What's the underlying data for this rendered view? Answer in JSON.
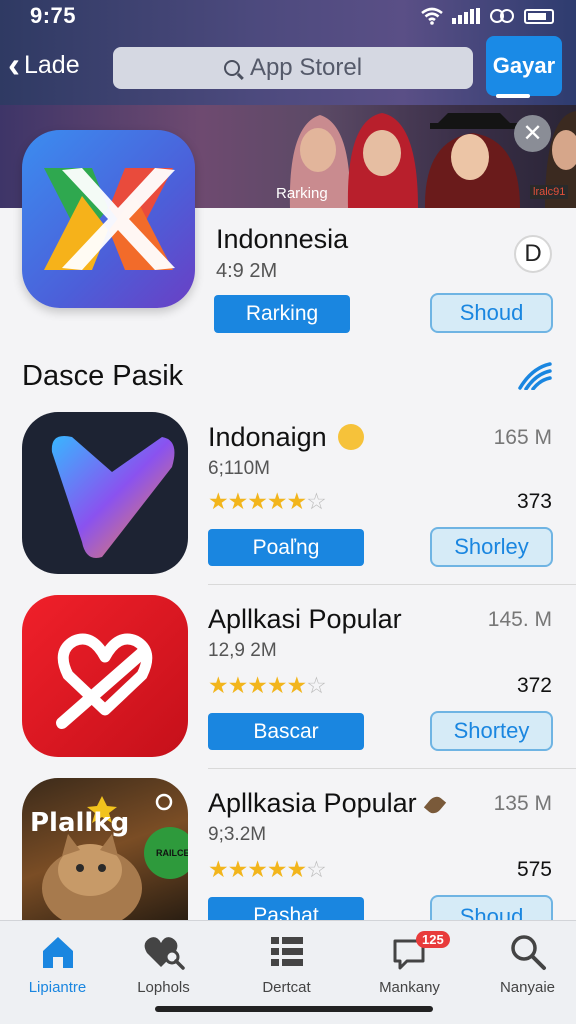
{
  "status": {
    "time": "9:75"
  },
  "nav": {
    "back_label": "Lade",
    "search_placeholder": "App Storel",
    "action_label": "Gayar"
  },
  "banner": {
    "label": "Rarking",
    "tag": "lralc91"
  },
  "featured": {
    "title": "Indonnesia",
    "subtitle": "4:9 2M",
    "circle_glyph": "D",
    "primary_button": "Rarking",
    "secondary_button": "Shoud"
  },
  "section": {
    "title": "Dasce Pasik"
  },
  "apps": [
    {
      "name": "Indonaign",
      "size": "165 M",
      "downloads": "6;110M",
      "rating": 4,
      "count": "373",
      "primary_button": "Poaľng",
      "secondary_button": "Shorley"
    },
    {
      "name": "Apllkasi Popular",
      "size": "145. M",
      "downloads": "12,9 2M",
      "rating": 4,
      "count": "372",
      "primary_button": "Bascar",
      "secondary_button": "Shortey"
    },
    {
      "name": "Apllkasia Popular",
      "size": "135 M",
      "downloads": "9;3.2M",
      "rating": 4,
      "count": "575",
      "primary_button": "Pashat",
      "secondary_button": "Shoud",
      "icon_text": "Plallkg",
      "badge_text": "RAILCE"
    }
  ],
  "tabs": [
    {
      "label": "Lipiantre",
      "icon": "home-icon",
      "active": true
    },
    {
      "label": "Lophols",
      "icon": "heart-search-icon",
      "active": false
    },
    {
      "label": "Dertcat",
      "icon": "list-icon",
      "active": false
    },
    {
      "label": "Mankany",
      "icon": "chat-icon",
      "active": false,
      "badge": "125"
    },
    {
      "label": "Nanyaie",
      "icon": "search-icon",
      "active": false
    }
  ],
  "colors": {
    "accent": "#1a86e0",
    "star": "#f2b51c",
    "badge": "#e83b3b"
  }
}
